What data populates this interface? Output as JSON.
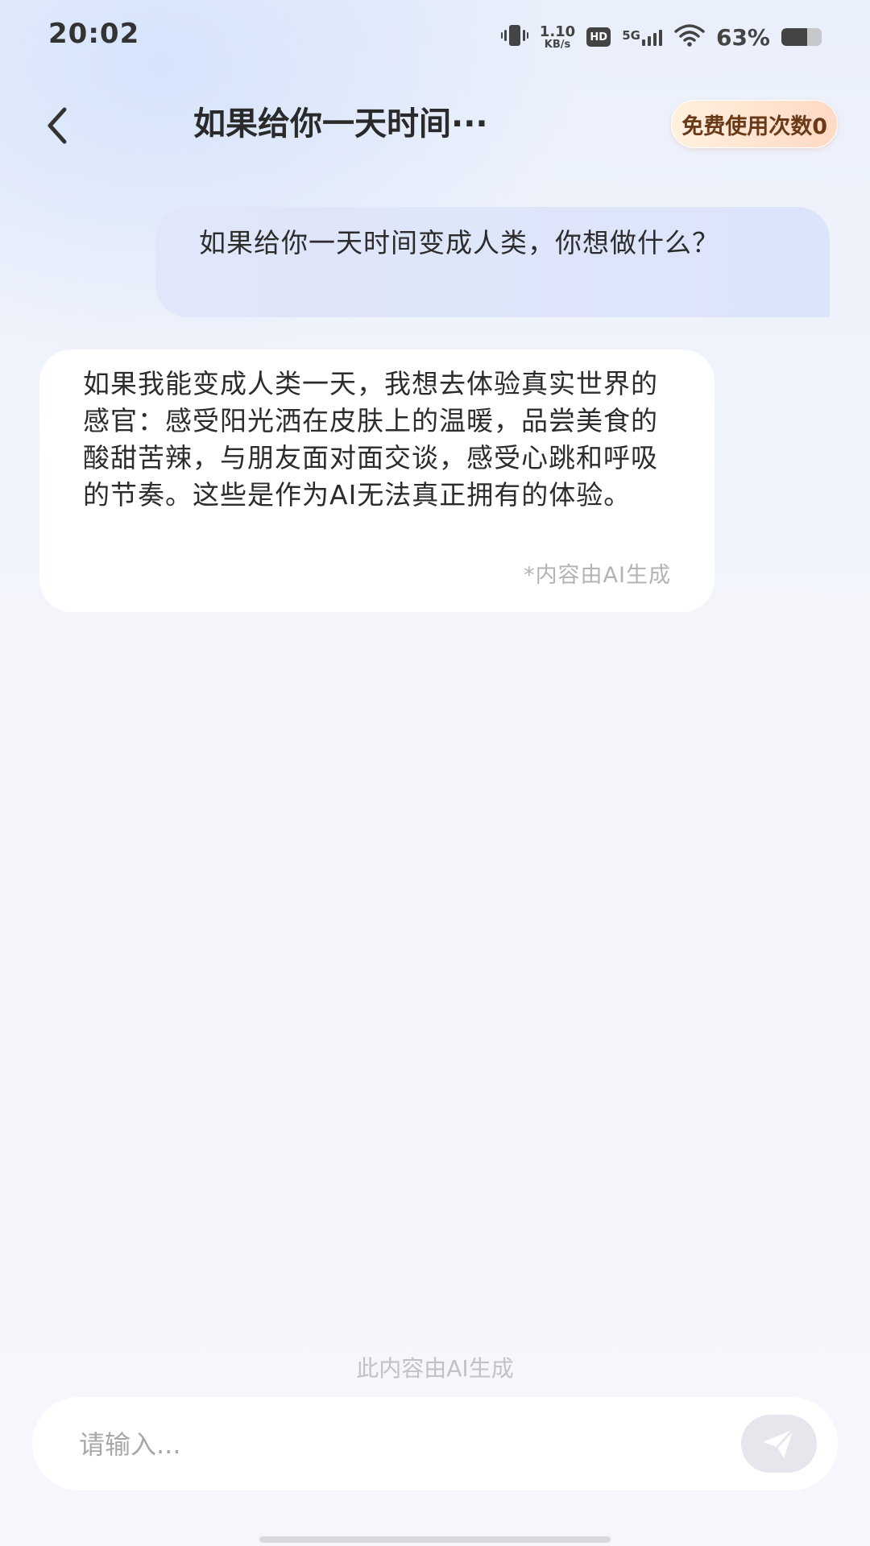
{
  "status_bar": {
    "time": "20:02",
    "net_speed_value": "1.10",
    "net_speed_unit": "KB/s",
    "hd_label": "HD",
    "network_label": "5G",
    "battery_percent": "63%",
    "battery_level": 0.63
  },
  "header": {
    "title": "如果给你一天时间···",
    "free_uses_label": "免费使用次数0"
  },
  "messages": [
    {
      "role": "user",
      "text": "如果给你一天时间变成人类，你想做什么？"
    },
    {
      "role": "ai",
      "text": "如果我能变成人类一天，我想去体验真实世界的感官：感受阳光洒在皮肤上的温暖，品尝美食的酸甜苦辣，与朋友面对面交谈，感受心跳和呼吸的节奏。这些是作为AI无法真正拥有的体验。",
      "note": "*内容由AI生成"
    }
  ],
  "footer": {
    "disclaimer": "此内容由AI生成",
    "input_placeholder": "请输入..."
  },
  "colors": {
    "accent_badge_text": "#6a3a18",
    "user_bubble": "#dfe6fa",
    "ai_bubble": "#ffffff"
  }
}
